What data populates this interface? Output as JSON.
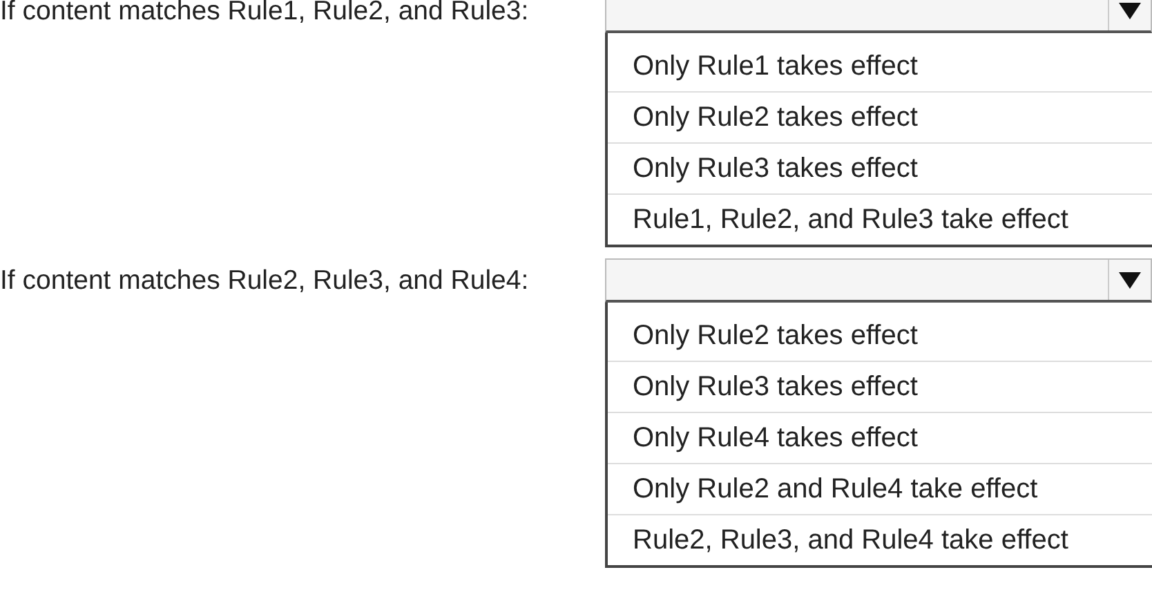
{
  "questions": [
    {
      "label": "If content matches Rule1, Rule2, and Rule3:",
      "options": [
        "Only Rule1 takes effect",
        "Only Rule2 takes effect",
        "Only Rule3 takes effect",
        "Rule1, Rule2, and Rule3 take effect"
      ]
    },
    {
      "label": "If content matches Rule2, Rule3, and Rule4:",
      "options": [
        "Only Rule2 takes effect",
        "Only Rule3 takes effect",
        "Only Rule4 takes effect",
        "Only Rule2 and Rule4 take effect",
        "Rule2, Rule3, and Rule4 take effect"
      ]
    }
  ]
}
